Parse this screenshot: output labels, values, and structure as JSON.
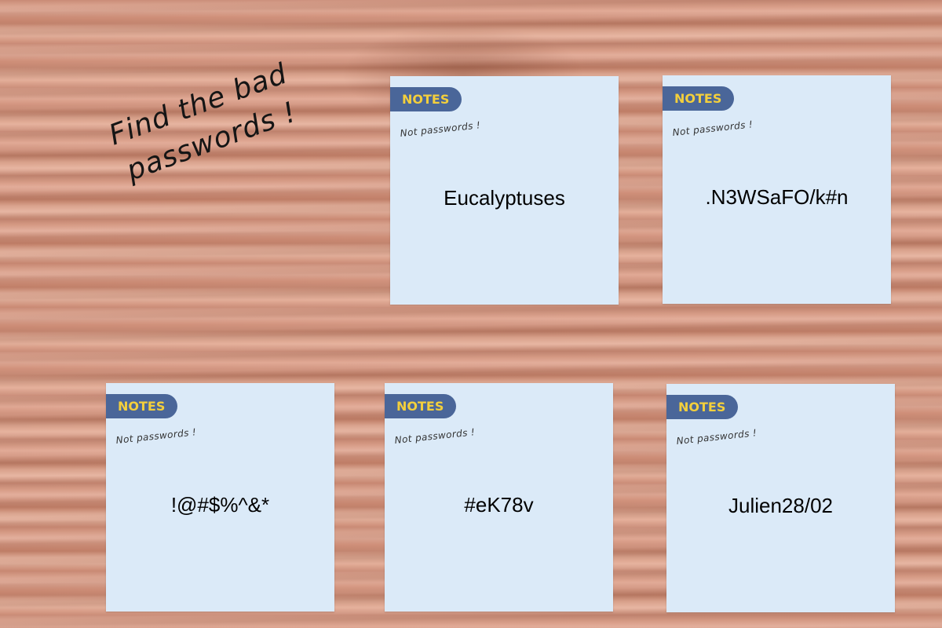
{
  "headline": {
    "line1": "Find the bad",
    "line2": "passwords !"
  },
  "notes": [
    {
      "tag": "NOTES",
      "subtitle": "Not passwords !",
      "value": "Eucalyptuses"
    },
    {
      "tag": "NOTES",
      "subtitle": "Not passwords !",
      "value": ".N3WSaFO/k#n"
    },
    {
      "tag": "NOTES",
      "subtitle": "Not passwords !",
      "value": "!@#$%^&*"
    },
    {
      "tag": "NOTES",
      "subtitle": "Not passwords !",
      "value": "#eK78v"
    },
    {
      "tag": "NOTES",
      "subtitle": "Not passwords !",
      "value": "Julien28/02"
    }
  ],
  "colors": {
    "note_bg": "#dbeaf8",
    "tag_bg": "#4a6699",
    "tag_text": "#f3cf3c"
  }
}
